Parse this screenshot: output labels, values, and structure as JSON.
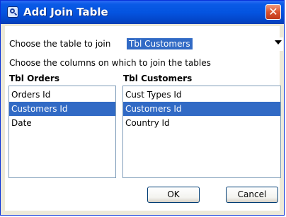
{
  "window": {
    "title": "Add Join Table",
    "close_glyph": "✕"
  },
  "table_chooser": {
    "label": "Choose the table to join",
    "selected_value": "Tbl Customers"
  },
  "columns_instruction": "Choose the columns on which to join the tables",
  "left_list": {
    "heading": "Tbl Orders",
    "items": [
      {
        "label": "Orders Id",
        "selected": false
      },
      {
        "label": "Customers Id",
        "selected": true
      },
      {
        "label": "Date",
        "selected": false
      }
    ]
  },
  "right_list": {
    "heading": "Tbl Customers",
    "items": [
      {
        "label": "Cust Types Id",
        "selected": false
      },
      {
        "label": "Customers Id",
        "selected": true
      },
      {
        "label": "Country Id",
        "selected": false
      }
    ]
  },
  "buttons": {
    "ok_label": "OK",
    "cancel_label": "Cancel"
  },
  "colors": {
    "titlebar": "#0454e0",
    "selection": "#316ac5",
    "dialog_background": "#ece9d8"
  }
}
